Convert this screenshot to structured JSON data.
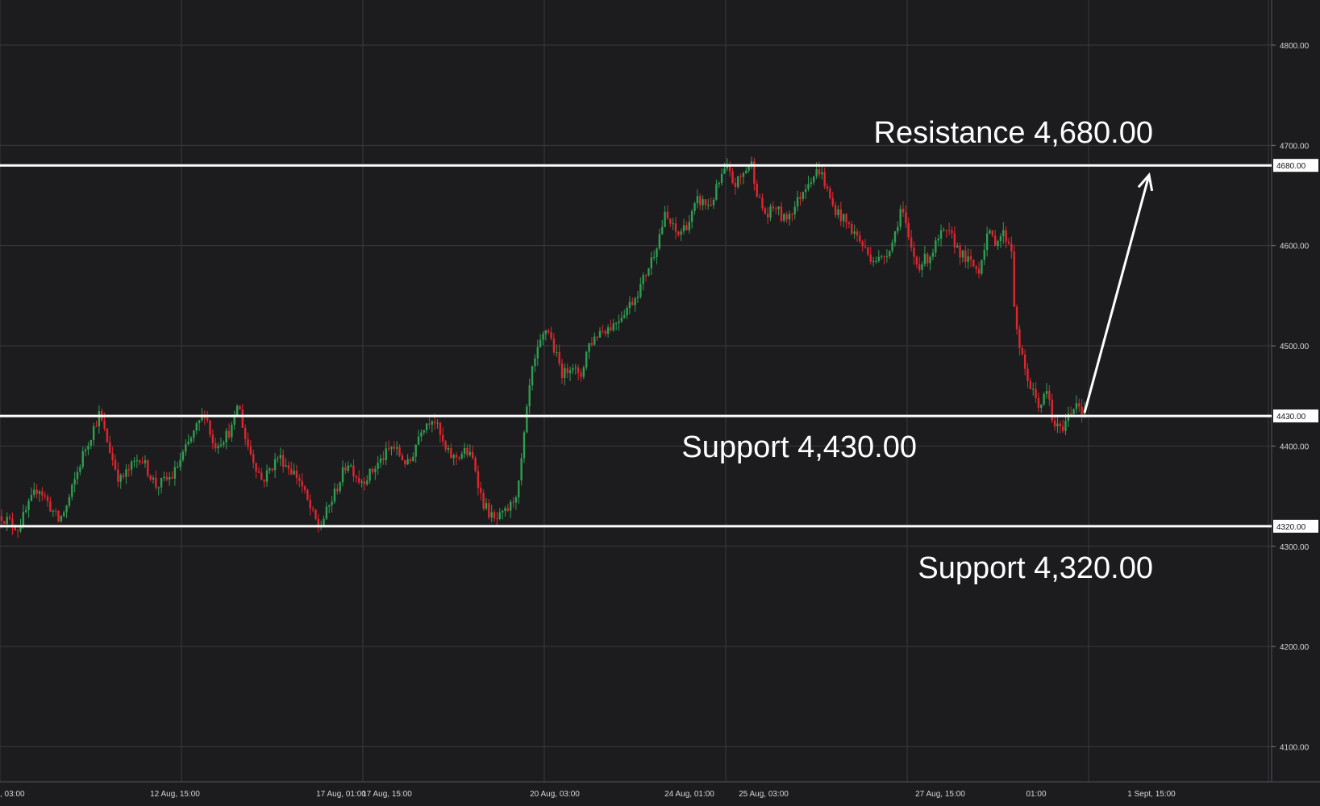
{
  "chart_data": {
    "type": "candlestick",
    "y_axis": {
      "ticks": [
        4100,
        4200,
        4300,
        4400,
        4500,
        4600,
        4700,
        4800
      ],
      "tick_labels": [
        "4100.00",
        "4200.00",
        "4300.00",
        "4400.00",
        "4500.00",
        "4600.00",
        "4700.00",
        "4800.00"
      ],
      "ylim": [
        4065,
        4845
      ],
      "position": "right"
    },
    "x_axis": {
      "tick_labels": [
        ", 03:00",
        "12 Aug, 15:00",
        "17 Aug, 01:00",
        "17 Aug, 15:00",
        "20 Aug, 03:00",
        "24 Aug, 01:00",
        "25 Aug, 03:00",
        "27 Aug, 15:00",
        "01:00",
        "1 Sept, 15:00"
      ]
    },
    "grid": true,
    "colors": {
      "background": "#1c1c1f",
      "up": "#2e9e4f",
      "down": "#e0262d",
      "levels": "#ffffff"
    },
    "levels": [
      {
        "value": 4680,
        "tag": "4680.00",
        "annotation": "Resistance 4,680.00"
      },
      {
        "value": 4430,
        "tag": "4430.00",
        "annotation": "Support 4,430.00"
      },
      {
        "value": 4320,
        "tag": "4320.00",
        "annotation": "Support 4,320.00"
      }
    ],
    "projection": {
      "from": 4430,
      "to": 4680,
      "direction": "up"
    },
    "price_path": [
      [
        0,
        4330
      ],
      [
        4,
        4318
      ],
      [
        9,
        4360
      ],
      [
        14,
        4325
      ],
      [
        16,
        4340
      ],
      [
        20,
        4392
      ],
      [
        24,
        4432
      ],
      [
        27,
        4390
      ],
      [
        29,
        4365
      ],
      [
        34,
        4390
      ],
      [
        38,
        4360
      ],
      [
        42,
        4370
      ],
      [
        45,
        4395
      ],
      [
        50,
        4435
      ],
      [
        52,
        4400
      ],
      [
        55,
        4410
      ],
      [
        57,
        4420
      ],
      [
        58,
        4445
      ],
      [
        60,
        4405
      ],
      [
        64,
        4365
      ],
      [
        68,
        4390
      ],
      [
        73,
        4368
      ],
      [
        76,
        4335
      ],
      [
        78,
        4318
      ],
      [
        81,
        4345
      ],
      [
        85,
        4385
      ],
      [
        88,
        4365
      ],
      [
        90,
        4370
      ],
      [
        93,
        4385
      ],
      [
        96,
        4400
      ],
      [
        100,
        4380
      ],
      [
        103,
        4418
      ],
      [
        106,
        4430
      ],
      [
        109,
        4395
      ],
      [
        111,
        4388
      ],
      [
        114,
        4395
      ],
      [
        116,
        4385
      ],
      [
        118,
        4345
      ],
      [
        121,
        4325
      ],
      [
        123,
        4330
      ],
      [
        125,
        4340
      ],
      [
        127,
        4360
      ],
      [
        130,
        4470
      ],
      [
        132,
        4498
      ],
      [
        134,
        4520
      ],
      [
        136,
        4492
      ],
      [
        138,
        4470
      ],
      [
        140,
        4484
      ],
      [
        142,
        4465
      ],
      [
        144,
        4500
      ],
      [
        147,
        4515
      ],
      [
        150,
        4520
      ],
      [
        153,
        4535
      ],
      [
        155,
        4545
      ],
      [
        157,
        4560
      ],
      [
        160,
        4590
      ],
      [
        163,
        4630
      ],
      [
        166,
        4610
      ],
      [
        169,
        4625
      ],
      [
        171,
        4645
      ],
      [
        174,
        4640
      ],
      [
        176,
        4660
      ],
      [
        178,
        4678
      ],
      [
        180,
        4660
      ],
      [
        182,
        4670
      ],
      [
        184,
        4685
      ],
      [
        186,
        4645
      ],
      [
        188,
        4628
      ],
      [
        190,
        4640
      ],
      [
        192,
        4625
      ],
      [
        195,
        4640
      ],
      [
        198,
        4665
      ],
      [
        201,
        4676
      ],
      [
        204,
        4640
      ],
      [
        207,
        4625
      ],
      [
        210,
        4610
      ],
      [
        213,
        4590
      ],
      [
        216,
        4585
      ],
      [
        219,
        4605
      ],
      [
        221,
        4640
      ],
      [
        223,
        4600
      ],
      [
        225,
        4580
      ],
      [
        228,
        4590
      ],
      [
        231,
        4612
      ],
      [
        233,
        4610
      ],
      [
        236,
        4590
      ],
      [
        238,
        4582
      ],
      [
        240,
        4575
      ],
      [
        242,
        4612
      ],
      [
        244,
        4605
      ],
      [
        246,
        4612
      ],
      [
        248,
        4600
      ],
      [
        249,
        4520
      ],
      [
        251,
        4480
      ],
      [
        253,
        4455
      ],
      [
        255,
        4440
      ],
      [
        257,
        4455
      ],
      [
        258,
        4425
      ],
      [
        260,
        4415
      ],
      [
        262,
        4430
      ],
      [
        264,
        4445
      ],
      [
        266,
        4432
      ]
    ]
  }
}
